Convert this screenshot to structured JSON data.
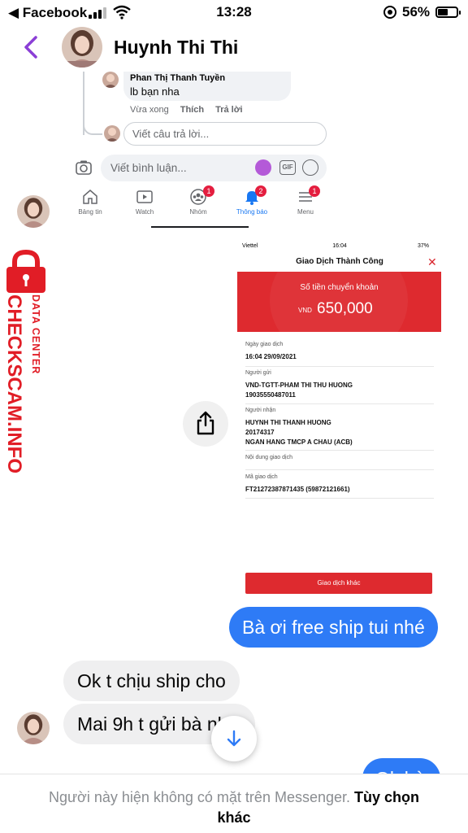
{
  "status_bar": {
    "back_app": "◀ Facebook",
    "time": "13:28",
    "battery": "56%"
  },
  "header": {
    "contact_name": "Huynh Thi Thi"
  },
  "fb_screenshot": {
    "comment_author": "Phan Thị Thanh Tuyền",
    "comment_text": "lb bạn nha",
    "comment_time": "Vừa xong",
    "like": "Thích",
    "reply": "Trả lời",
    "reply_placeholder": "Viết câu trả lời...",
    "comment_placeholder": "Viết bình luận...",
    "gif": "GIF",
    "nav": [
      {
        "label": "Bảng tin",
        "badge": ""
      },
      {
        "label": "Watch",
        "badge": ""
      },
      {
        "label": "Nhóm",
        "badge": "1"
      },
      {
        "label": "Thông báo",
        "badge": "2"
      },
      {
        "label": "Menu",
        "badge": "1"
      }
    ]
  },
  "watermark": {
    "brand": "CHECKSCAM.INFO",
    "sub": "DATA CENTER"
  },
  "receipt": {
    "carrier": "Viettel",
    "time": "16:04",
    "battery": "37%",
    "title": "Giao Dịch Thành Công",
    "banner_label": "Số tiền chuyển khoản",
    "currency": "VND",
    "amount": "650,000",
    "fields": {
      "date_label": "Ngày giao dịch",
      "date_value": "16:04 29/09/2021",
      "sender_label": "Người gửi",
      "sender_line1": "VND-TGTT-PHAM THI THU HUONG",
      "sender_line2": "19035550487011",
      "receiver_label": "Người nhận",
      "receiver_line1": "HUYNH THI THANH HUONG",
      "receiver_line2": "20174317",
      "receiver_line3": "NGAN HANG TMCP A CHAU (ACB)",
      "content_label": "Nội dung giao dịch",
      "code_label": "Mã giao dịch",
      "code_value": "FT21272387871435 (59872121661)"
    },
    "button": "Giao dịch khác"
  },
  "messages": {
    "out_1": "Bà ơi free ship tui nhé",
    "in_1": "Ok t chịu ship cho",
    "in_2": "Mai 9h t gửi bà nha",
    "out_partial": "Ok bà"
  },
  "footer": {
    "notice": "Người này hiện không có mặt trên Messenger.",
    "more": "Tùy chọn khác"
  },
  "colors": {
    "messenger_blue": "#2e7bf6",
    "header_accent": "#8b3fd6",
    "bank_red": "#de2a2f",
    "watermark_red": "#e11d26"
  }
}
